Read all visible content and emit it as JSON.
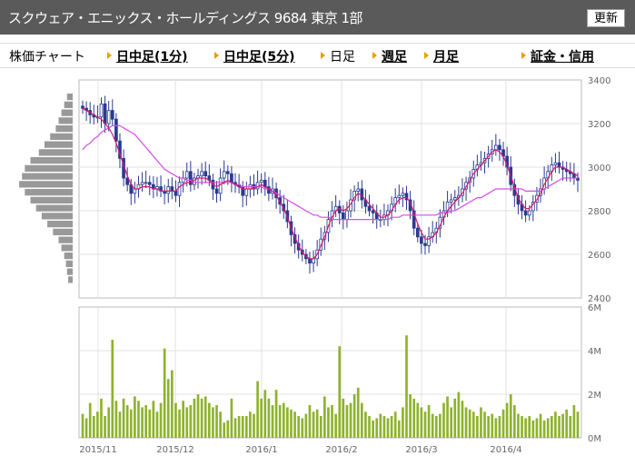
{
  "header": {
    "title": "スクウェア・エニックス・ホールディングス 9684 東京 1部",
    "refresh_label": "更新"
  },
  "nav": {
    "label": "株価チャート",
    "items": [
      {
        "label": "日中足(1分)",
        "bold": true
      },
      {
        "label": "日中足(5分)",
        "bold": true
      },
      {
        "label": "日足",
        "bold": false
      },
      {
        "label": "週足",
        "bold": true
      },
      {
        "label": "月足",
        "bold": true
      },
      {
        "label": "証金・信用",
        "bold": true
      }
    ]
  },
  "chart_data": [
    {
      "type": "candlestick",
      "y_ticks": [
        "3400",
        "3200",
        "3000",
        "2800",
        "2600",
        "2400"
      ],
      "ylim": [
        2400,
        3400
      ],
      "x_ticks": [
        "2015/11",
        "2015/12",
        "2016/1",
        "2016/2",
        "2016/3",
        "2016/4"
      ],
      "grid": true,
      "close": [
        3270,
        3260,
        3240,
        3230,
        3230,
        3290,
        3200,
        3260,
        3220,
        3120,
        3040,
        2950,
        2920,
        2880,
        2900,
        2920,
        2930,
        2930,
        2920,
        2900,
        2910,
        2890,
        2880,
        2910,
        2890,
        2870,
        2930,
        2950,
        2980,
        2920,
        2950,
        2960,
        2980,
        2960,
        2940,
        2900,
        2880,
        2950,
        2980,
        2970,
        2930,
        2920,
        2910,
        2870,
        2900,
        2920,
        2900,
        2930,
        2940,
        2910,
        2880,
        2900,
        2860,
        2830,
        2800,
        2750,
        2690,
        2650,
        2620,
        2600,
        2580,
        2560,
        2580,
        2620,
        2670,
        2700,
        2760,
        2800,
        2820,
        2790,
        2760,
        2800,
        2850,
        2890,
        2900,
        2850,
        2820,
        2800,
        2790,
        2760,
        2760,
        2780,
        2800,
        2830,
        2860,
        2870,
        2880,
        2850,
        2800,
        2720,
        2680,
        2650,
        2640,
        2680,
        2700,
        2720,
        2770,
        2800,
        2840,
        2850,
        2860,
        2870,
        2900,
        2930,
        2950,
        2990,
        3010,
        3020,
        3040,
        3060,
        3080,
        3100,
        3080,
        3050,
        3000,
        2920,
        2870,
        2830,
        2800,
        2780,
        2800,
        2840,
        2870,
        2900,
        2950,
        2980,
        3010,
        3020,
        3000,
        2990,
        2980,
        2970,
        2950,
        2940
      ],
      "ma_short": [
        3270,
        3260,
        3250,
        3240,
        3230,
        3220,
        3200,
        3180,
        3150,
        3110,
        3060,
        3010,
        2960,
        2920,
        2900,
        2900,
        2910,
        2910,
        2910,
        2900,
        2900,
        2890,
        2890,
        2890,
        2890,
        2890,
        2910,
        2920,
        2930,
        2930,
        2940,
        2950,
        2950,
        2950,
        2940,
        2920,
        2910,
        2920,
        2930,
        2940,
        2930,
        2920,
        2910,
        2900,
        2900,
        2900,
        2900,
        2910,
        2920,
        2910,
        2900,
        2890,
        2870,
        2840,
        2810,
        2770,
        2720,
        2680,
        2640,
        2610,
        2590,
        2580,
        2580,
        2600,
        2640,
        2680,
        2730,
        2770,
        2800,
        2810,
        2800,
        2810,
        2830,
        2860,
        2880,
        2870,
        2850,
        2830,
        2810,
        2790,
        2770,
        2770,
        2780,
        2800,
        2830,
        2850,
        2860,
        2860,
        2840,
        2790,
        2740,
        2700,
        2670,
        2670,
        2680,
        2700,
        2730,
        2770,
        2800,
        2820,
        2840,
        2860,
        2880,
        2910,
        2940,
        2970,
        2990,
        3010,
        3030,
        3050,
        3070,
        3080,
        3070,
        3050,
        3010,
        2960,
        2910,
        2860,
        2830,
        2810,
        2810,
        2830,
        2850,
        2880,
        2920,
        2950,
        2980,
        3000,
        3000,
        3000,
        2990,
        2980,
        2970,
        2960
      ],
      "ma_long": [
        3080,
        3100,
        3110,
        3130,
        3140,
        3160,
        3170,
        3180,
        3190,
        3190,
        3190,
        3180,
        3170,
        3160,
        3150,
        3130,
        3110,
        3090,
        3070,
        3050,
        3030,
        3010,
        2990,
        2980,
        2970,
        2960,
        2950,
        2950,
        2940,
        2940,
        2930,
        2930,
        2930,
        2930,
        2930,
        2930,
        2930,
        2930,
        2930,
        2930,
        2930,
        2920,
        2920,
        2910,
        2910,
        2910,
        2910,
        2910,
        2910,
        2900,
        2900,
        2890,
        2880,
        2870,
        2860,
        2850,
        2840,
        2830,
        2820,
        2810,
        2800,
        2790,
        2780,
        2780,
        2770,
        2770,
        2770,
        2760,
        2760,
        2760,
        2760,
        2760,
        2760,
        2760,
        2760,
        2760,
        2760,
        2760,
        2760,
        2760,
        2760,
        2760,
        2760,
        2770,
        2770,
        2770,
        2780,
        2780,
        2780,
        2780,
        2780,
        2780,
        2780,
        2780,
        2780,
        2780,
        2790,
        2790,
        2790,
        2800,
        2800,
        2810,
        2820,
        2830,
        2840,
        2850,
        2860,
        2860,
        2870,
        2880,
        2890,
        2900,
        2900,
        2900,
        2900,
        2900,
        2900,
        2900,
        2900,
        2890,
        2890,
        2890,
        2890,
        2890,
        2900,
        2910,
        2920,
        2930,
        2940,
        2950,
        2950,
        2950,
        2950,
        2950
      ],
      "volume_profile": [
        0.1,
        0.15,
        0.2,
        0.25,
        0.3,
        0.4,
        0.5,
        0.6,
        0.75,
        0.85,
        0.9,
        0.95,
        0.85,
        0.75,
        0.65,
        0.55,
        0.45,
        0.35,
        0.25,
        0.2,
        0.15,
        0.12,
        0.1,
        0.08
      ]
    },
    {
      "type": "bar",
      "y_ticks": [
        "6M",
        "4M",
        "2M",
        "0M"
      ],
      "ylim": [
        0,
        6
      ],
      "unit": "M",
      "values": [
        1.1,
        0.9,
        1.6,
        1.0,
        1.2,
        1.8,
        1.0,
        1.4,
        4.5,
        1.7,
        1.2,
        1.8,
        1.5,
        1.3,
        1.9,
        1.7,
        1.4,
        1.5,
        1.3,
        1.7,
        1.2,
        1.6,
        4.1,
        2.7,
        3.1,
        1.6,
        1.3,
        1.7,
        1.4,
        1.5,
        1.8,
        2.0,
        1.8,
        1.9,
        1.6,
        1.4,
        1.5,
        1.2,
        0.7,
        0.8,
        1.8,
        0.9,
        1.0,
        1.0,
        1.0,
        1.2,
        1.1,
        2.6,
        1.8,
        2.2,
        1.8,
        1.5,
        2.2,
        1.5,
        1.6,
        1.4,
        1.3,
        1.2,
        1.0,
        0.9,
        1.1,
        1.5,
        1.2,
        1.3,
        1.0,
        1.9,
        1.4,
        1.5,
        1.1,
        4.2,
        1.8,
        1.5,
        1.6,
        2.0,
        2.3,
        1.6,
        1.2,
        1.0,
        0.8,
        0.9,
        1.1,
        1.0,
        0.9,
        1.0,
        1.2,
        0.8,
        1.4,
        4.7,
        2.0,
        1.8,
        1.6,
        1.4,
        1.2,
        1.5,
        1.1,
        1.0,
        1.1,
        1.6,
        1.9,
        1.4,
        1.8,
        2.1,
        1.7,
        1.4,
        1.3,
        1.2,
        1.0,
        1.4,
        1.2,
        1.0,
        1.1,
        0.9,
        1.0,
        1.3,
        1.6,
        2.0,
        1.5,
        1.1,
        1.0,
        0.9,
        1.0,
        0.8,
        0.9,
        1.1,
        0.8,
        0.9,
        1.0,
        1.2,
        1.0,
        1.1,
        1.3,
        1.0,
        1.5,
        1.2
      ]
    }
  ],
  "colors": {
    "up": "#ffffff",
    "down": "#2b3a8f",
    "candle_border": "#2b3a8f",
    "ma_short": "#d6186e",
    "ma_long": "#d44de8",
    "volume": "#8eb22e",
    "profile": "#999999",
    "grid": "#e2e2e2",
    "frame": "#bbbbbb"
  }
}
